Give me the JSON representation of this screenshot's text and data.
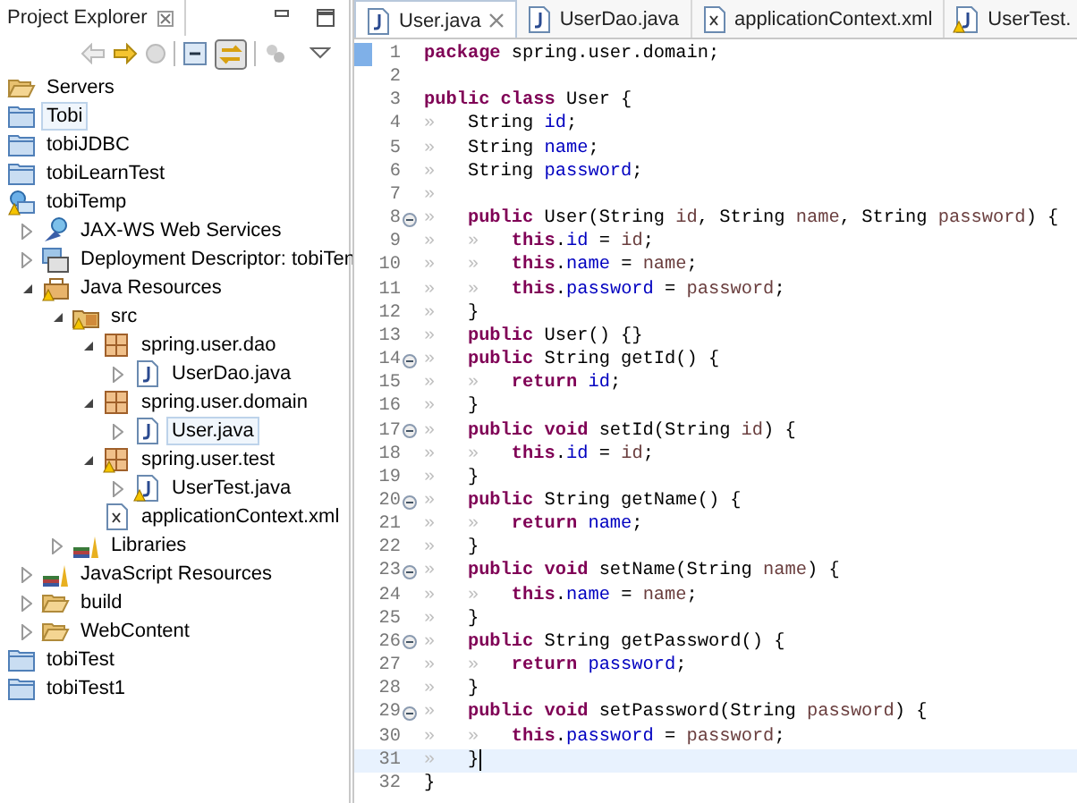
{
  "explorer": {
    "title": "Project Explorer",
    "tree": [
      {
        "label": "Servers",
        "kind": "folder-open",
        "selected": false,
        "warning": false
      },
      {
        "label": "Tobi",
        "kind": "project",
        "selected": true,
        "warning": false
      },
      {
        "label": "tobiJDBC",
        "kind": "project",
        "selected": false,
        "warning": false
      },
      {
        "label": "tobiLearnTest",
        "kind": "project",
        "selected": false,
        "warning": false
      },
      {
        "label": "tobiTemp",
        "kind": "web-project",
        "selected": false,
        "warning": true,
        "children": [
          {
            "label": "JAX-WS Web Services",
            "kind": "web-services",
            "selected": false,
            "warning": false,
            "expanded": false
          },
          {
            "label": "Deployment Descriptor: tobiTen",
            "kind": "descriptor",
            "selected": false,
            "warning": false,
            "expanded": false
          },
          {
            "label": "Java Resources",
            "kind": "java-resources",
            "selected": false,
            "warning": true,
            "expanded": true,
            "children": [
              {
                "label": "src",
                "kind": "source-folder",
                "selected": false,
                "warning": true,
                "expanded": true,
                "children": [
                  {
                    "label": "spring.user.dao",
                    "kind": "package",
                    "selected": false,
                    "warning": false,
                    "expanded": true,
                    "children": [
                      {
                        "label": "UserDao.java",
                        "kind": "java-file",
                        "selected": false,
                        "warning": false,
                        "expanded": false
                      }
                    ]
                  },
                  {
                    "label": "spring.user.domain",
                    "kind": "package",
                    "selected": false,
                    "warning": false,
                    "expanded": true,
                    "children": [
                      {
                        "label": "User.java",
                        "kind": "java-file",
                        "selected": true,
                        "warning": false,
                        "expanded": false
                      }
                    ]
                  },
                  {
                    "label": "spring.user.test",
                    "kind": "package",
                    "selected": false,
                    "warning": true,
                    "expanded": true,
                    "children": [
                      {
                        "label": "UserTest.java",
                        "kind": "java-file",
                        "selected": false,
                        "warning": true,
                        "expanded": false
                      }
                    ]
                  },
                  {
                    "label": "applicationContext.xml",
                    "kind": "xml-file",
                    "selected": false,
                    "warning": false
                  }
                ]
              },
              {
                "label": "Libraries",
                "kind": "library",
                "selected": false,
                "warning": false,
                "expanded": false
              }
            ]
          },
          {
            "label": "JavaScript Resources",
            "kind": "library",
            "selected": false,
            "warning": false,
            "expanded": false
          },
          {
            "label": "build",
            "kind": "folder-open",
            "selected": false,
            "warning": false,
            "expanded": false
          },
          {
            "label": "WebContent",
            "kind": "folder-open",
            "selected": false,
            "warning": false,
            "expanded": false
          }
        ]
      },
      {
        "label": "tobiTest",
        "kind": "project",
        "selected": false,
        "warning": false
      },
      {
        "label": "tobiTest1",
        "kind": "project",
        "selected": false,
        "warning": false
      }
    ]
  },
  "editor": {
    "tabs": [
      {
        "label": "User.java",
        "kind": "java-file",
        "selected": true,
        "warning": false
      },
      {
        "label": "UserDao.java",
        "kind": "java-file",
        "selected": false,
        "warning": false
      },
      {
        "label": "applicationContext.xml",
        "kind": "xml-file",
        "selected": false,
        "warning": false
      },
      {
        "label": "UserTest.",
        "kind": "java-file",
        "selected": false,
        "warning": true
      }
    ],
    "lines": [
      {
        "number": "1",
        "fold": false,
        "marked": true,
        "current": false,
        "tokens": [
          {
            "kind": "keyword",
            "text": "package"
          },
          {
            "kind": "plain",
            "text": " spring.user.domain;"
          }
        ]
      },
      {
        "number": "2",
        "fold": false,
        "marked": false,
        "current": false
      },
      {
        "number": "3",
        "fold": false,
        "marked": false,
        "current": false,
        "tokens": [
          {
            "kind": "keyword",
            "text": "public class"
          },
          {
            "kind": "plain",
            "text": " User {"
          }
        ]
      },
      {
        "number": "4",
        "fold": false,
        "marked": false,
        "current": false,
        "tokens": [
          {
            "kind": "tab",
            "text": "»"
          },
          {
            "kind": "plain",
            "text": "String "
          },
          {
            "kind": "field",
            "text": "id"
          },
          {
            "kind": "plain",
            "text": ";"
          }
        ]
      },
      {
        "number": "5",
        "fold": false,
        "marked": false,
        "current": false,
        "tokens": [
          {
            "kind": "tab",
            "text": "»"
          },
          {
            "kind": "plain",
            "text": "String "
          },
          {
            "kind": "field",
            "text": "name"
          },
          {
            "kind": "plain",
            "text": ";"
          }
        ]
      },
      {
        "number": "6",
        "fold": false,
        "marked": false,
        "current": false,
        "tokens": [
          {
            "kind": "tab",
            "text": "»"
          },
          {
            "kind": "plain",
            "text": "String "
          },
          {
            "kind": "field",
            "text": "password"
          },
          {
            "kind": "plain",
            "text": ";"
          }
        ]
      },
      {
        "number": "7",
        "fold": false,
        "marked": false,
        "current": false,
        "tokens": [
          {
            "kind": "tab",
            "text": "»"
          }
        ]
      },
      {
        "number": "8",
        "fold": true,
        "marked": false,
        "current": false,
        "tokens": [
          {
            "kind": "tab",
            "text": "»"
          },
          {
            "kind": "keyword",
            "text": "public"
          },
          {
            "kind": "plain",
            "text": " User(String "
          },
          {
            "kind": "param",
            "text": "id"
          },
          {
            "kind": "plain",
            "text": ", String "
          },
          {
            "kind": "param",
            "text": "name"
          },
          {
            "kind": "plain",
            "text": ", String "
          },
          {
            "kind": "param",
            "text": "password"
          },
          {
            "kind": "plain",
            "text": ") {"
          }
        ]
      },
      {
        "number": "9",
        "fold": false,
        "marked": false,
        "current": false,
        "tokens": [
          {
            "kind": "tab",
            "text": "»"
          },
          {
            "kind": "tab",
            "text": "»"
          },
          {
            "kind": "keyword",
            "text": "this"
          },
          {
            "kind": "plain",
            "text": "."
          },
          {
            "kind": "field",
            "text": "id"
          },
          {
            "kind": "plain",
            "text": " = "
          },
          {
            "kind": "param",
            "text": "id"
          },
          {
            "kind": "plain",
            "text": ";"
          }
        ]
      },
      {
        "number": "10",
        "fold": false,
        "marked": false,
        "current": false,
        "tokens": [
          {
            "kind": "tab",
            "text": "»"
          },
          {
            "kind": "tab",
            "text": "»"
          },
          {
            "kind": "keyword",
            "text": "this"
          },
          {
            "kind": "plain",
            "text": "."
          },
          {
            "kind": "field",
            "text": "name"
          },
          {
            "kind": "plain",
            "text": " = "
          },
          {
            "kind": "param",
            "text": "name"
          },
          {
            "kind": "plain",
            "text": ";"
          }
        ]
      },
      {
        "number": "11",
        "fold": false,
        "marked": false,
        "current": false,
        "tokens": [
          {
            "kind": "tab",
            "text": "»"
          },
          {
            "kind": "tab",
            "text": "»"
          },
          {
            "kind": "keyword",
            "text": "this"
          },
          {
            "kind": "plain",
            "text": "."
          },
          {
            "kind": "field",
            "text": "password"
          },
          {
            "kind": "plain",
            "text": " = "
          },
          {
            "kind": "param",
            "text": "password"
          },
          {
            "kind": "plain",
            "text": ";"
          }
        ]
      },
      {
        "number": "12",
        "fold": false,
        "marked": false,
        "current": false,
        "tokens": [
          {
            "kind": "tab",
            "text": "»"
          },
          {
            "kind": "plain",
            "text": "}"
          }
        ]
      },
      {
        "number": "13",
        "fold": false,
        "marked": false,
        "current": false,
        "tokens": [
          {
            "kind": "tab",
            "text": "»"
          },
          {
            "kind": "keyword",
            "text": "public"
          },
          {
            "kind": "plain",
            "text": " User() {}"
          }
        ]
      },
      {
        "number": "14",
        "fold": true,
        "marked": false,
        "current": false,
        "tokens": [
          {
            "kind": "tab",
            "text": "»"
          },
          {
            "kind": "keyword",
            "text": "public"
          },
          {
            "kind": "plain",
            "text": " String getId() {"
          }
        ]
      },
      {
        "number": "15",
        "fold": false,
        "marked": false,
        "current": false,
        "tokens": [
          {
            "kind": "tab",
            "text": "»"
          },
          {
            "kind": "tab",
            "text": "»"
          },
          {
            "kind": "keyword",
            "text": "return"
          },
          {
            "kind": "field",
            "text": "id"
          },
          {
            "kind": "plain",
            "text": ";"
          }
        ]
      },
      {
        "number": "16",
        "fold": false,
        "marked": false,
        "current": false,
        "tokens": [
          {
            "kind": "tab",
            "text": "»"
          },
          {
            "kind": "plain",
            "text": "}"
          }
        ]
      },
      {
        "number": "17",
        "fold": true,
        "marked": false,
        "current": false,
        "tokens": [
          {
            "kind": "tab",
            "text": "»"
          },
          {
            "kind": "keyword",
            "text": "public void"
          },
          {
            "kind": "plain",
            "text": " setId(String "
          },
          {
            "kind": "param",
            "text": "id"
          },
          {
            "kind": "plain",
            "text": ") {"
          }
        ]
      },
      {
        "number": "18",
        "fold": false,
        "marked": false,
        "current": false,
        "tokens": [
          {
            "kind": "tab",
            "text": "»"
          },
          {
            "kind": "tab",
            "text": "»"
          },
          {
            "kind": "keyword",
            "text": "this"
          },
          {
            "kind": "plain",
            "text": "."
          },
          {
            "kind": "field",
            "text": "id"
          },
          {
            "kind": "plain",
            "text": " = "
          },
          {
            "kind": "param",
            "text": "id"
          },
          {
            "kind": "plain",
            "text": ";"
          }
        ]
      },
      {
        "number": "19",
        "fold": false,
        "marked": false,
        "current": false,
        "tokens": [
          {
            "kind": "tab",
            "text": "»"
          },
          {
            "kind": "plain",
            "text": "}"
          }
        ]
      },
      {
        "number": "20",
        "fold": true,
        "marked": false,
        "current": false,
        "tokens": [
          {
            "kind": "tab",
            "text": "»"
          },
          {
            "kind": "keyword",
            "text": "public"
          },
          {
            "kind": "plain",
            "text": " String getName() {"
          }
        ]
      },
      {
        "number": "21",
        "fold": false,
        "marked": false,
        "current": false,
        "tokens": [
          {
            "kind": "tab",
            "text": "»"
          },
          {
            "kind": "tab",
            "text": "»"
          },
          {
            "kind": "keyword",
            "text": "return"
          },
          {
            "kind": "field",
            "text": "name"
          },
          {
            "kind": "plain",
            "text": ";"
          }
        ]
      },
      {
        "number": "22",
        "fold": false,
        "marked": false,
        "current": false,
        "tokens": [
          {
            "kind": "tab",
            "text": "»"
          },
          {
            "kind": "plain",
            "text": "}"
          }
        ]
      },
      {
        "number": "23",
        "fold": true,
        "marked": false,
        "current": false,
        "tokens": [
          {
            "kind": "tab",
            "text": "»"
          },
          {
            "kind": "keyword",
            "text": "public void"
          },
          {
            "kind": "plain",
            "text": " setName(String "
          },
          {
            "kind": "param",
            "text": "name"
          },
          {
            "kind": "plain",
            "text": ") {"
          }
        ]
      },
      {
        "number": "24",
        "fold": false,
        "marked": false,
        "current": false,
        "tokens": [
          {
            "kind": "tab",
            "text": "»"
          },
          {
            "kind": "tab",
            "text": "»"
          },
          {
            "kind": "keyword",
            "text": "this"
          },
          {
            "kind": "plain",
            "text": "."
          },
          {
            "kind": "field",
            "text": "name"
          },
          {
            "kind": "plain",
            "text": " = "
          },
          {
            "kind": "param",
            "text": "name"
          },
          {
            "kind": "plain",
            "text": ";"
          }
        ]
      },
      {
        "number": "25",
        "fold": false,
        "marked": false,
        "current": false,
        "tokens": [
          {
            "kind": "tab",
            "text": "»"
          },
          {
            "kind": "plain",
            "text": "}"
          }
        ]
      },
      {
        "number": "26",
        "fold": true,
        "marked": false,
        "current": false,
        "tokens": [
          {
            "kind": "tab",
            "text": "»"
          },
          {
            "kind": "keyword",
            "text": "public"
          },
          {
            "kind": "plain",
            "text": " String getPassword() {"
          }
        ]
      },
      {
        "number": "27",
        "fold": false,
        "marked": false,
        "current": false,
        "tokens": [
          {
            "kind": "tab",
            "text": "»"
          },
          {
            "kind": "tab",
            "text": "»"
          },
          {
            "kind": "keyword",
            "text": "return"
          },
          {
            "kind": "field",
            "text": "password"
          },
          {
            "kind": "plain",
            "text": ";"
          }
        ]
      },
      {
        "number": "28",
        "fold": false,
        "marked": false,
        "current": false,
        "tokens": [
          {
            "kind": "tab",
            "text": "»"
          },
          {
            "kind": "plain",
            "text": "}"
          }
        ]
      },
      {
        "number": "29",
        "fold": true,
        "marked": false,
        "current": false,
        "tokens": [
          {
            "kind": "tab",
            "text": "»"
          },
          {
            "kind": "keyword",
            "text": "public void"
          },
          {
            "kind": "plain",
            "text": " setPassword(String "
          },
          {
            "kind": "param",
            "text": "password"
          },
          {
            "kind": "plain",
            "text": ") {"
          }
        ]
      },
      {
        "number": "30",
        "fold": false,
        "marked": false,
        "current": false,
        "tokens": [
          {
            "kind": "tab",
            "text": "»"
          },
          {
            "kind": "tab",
            "text": "»"
          },
          {
            "kind": "keyword",
            "text": "this"
          },
          {
            "kind": "plain",
            "text": "."
          },
          {
            "kind": "field",
            "text": "password"
          },
          {
            "kind": "plain",
            "text": " = "
          },
          {
            "kind": "param",
            "text": "password"
          },
          {
            "kind": "plain",
            "text": ";"
          }
        ]
      },
      {
        "number": "31",
        "fold": false,
        "marked": false,
        "current": true,
        "tokens": [
          {
            "kind": "tab",
            "text": "»"
          },
          {
            "kind": "plain",
            "text": "}"
          }
        ]
      },
      {
        "number": "32",
        "fold": false,
        "marked": false,
        "current": false,
        "tokens": [
          {
            "kind": "plain",
            "text": "}"
          }
        ]
      }
    ]
  }
}
